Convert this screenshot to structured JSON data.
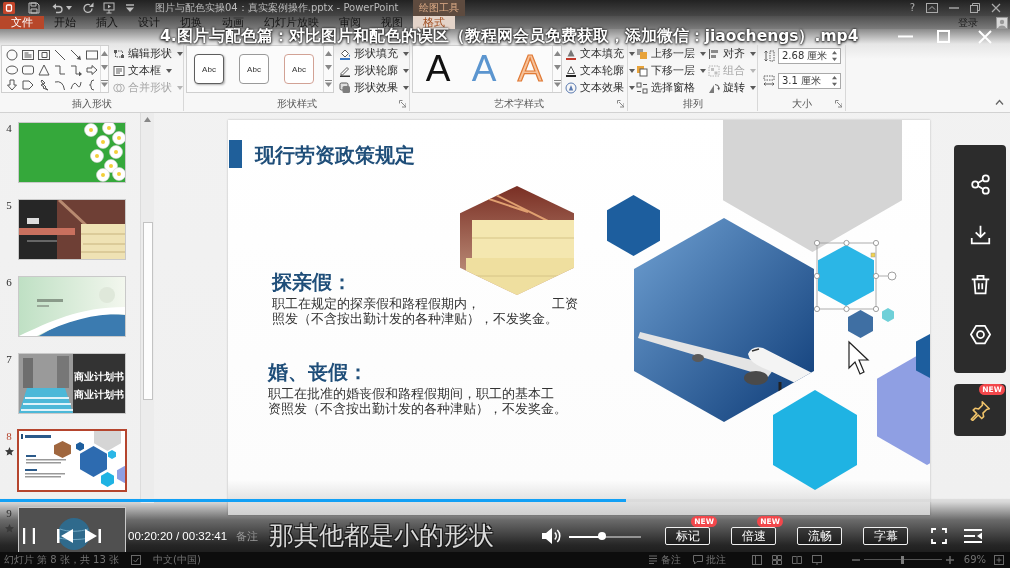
{
  "app": {
    "title": "图片与配色实操04：真实案例操作.pptx - PowerPoint",
    "context_label": "绘图工具",
    "help": "?",
    "tabs": [
      {
        "label": "文件",
        "kind": "file",
        "selected": false
      },
      {
        "label": "开始",
        "kind": "tab",
        "selected": false
      },
      {
        "label": "插入",
        "kind": "tab",
        "selected": false
      },
      {
        "label": "设计",
        "kind": "tab",
        "selected": false
      },
      {
        "label": "切换",
        "kind": "tab",
        "selected": false
      },
      {
        "label": "动画",
        "kind": "tab",
        "selected": false
      },
      {
        "label": "幻灯片放映",
        "kind": "tab",
        "selected": false
      },
      {
        "label": "审阅",
        "kind": "tab",
        "selected": false
      },
      {
        "label": "视图",
        "kind": "tab",
        "selected": false
      },
      {
        "label": "格式",
        "kind": "tab",
        "selected": true
      }
    ],
    "sign_in": "登录",
    "ribbon": [
      {
        "kind": "shapes",
        "label": "插入形状",
        "dialog_launcher": false,
        "commands": [
          {
            "label": "编辑形状",
            "dropdown": true,
            "disabled": false
          },
          {
            "label": "文本框",
            "dropdown": true,
            "disabled": false
          },
          {
            "label": "合并形状",
            "dropdown": true,
            "disabled": true
          }
        ]
      },
      {
        "kind": "styles",
        "label": "形状样式",
        "dialog_launcher": true,
        "swatches": [
          "Abc",
          "Abc",
          "Abc"
        ],
        "commands": [
          {
            "label": "形状填充",
            "dropdown": true,
            "disabled": false
          },
          {
            "label": "形状轮廓",
            "dropdown": true,
            "disabled": false
          },
          {
            "label": "形状效果",
            "dropdown": true,
            "disabled": false
          }
        ]
      },
      {
        "kind": "wordart",
        "label": "艺术字样式",
        "dialog_launcher": true,
        "swatches": [
          "A",
          "A",
          "A"
        ],
        "commands": [
          {
            "label": "文本填充",
            "dropdown": true,
            "disabled": false
          },
          {
            "label": "文本轮廓",
            "dropdown": true,
            "disabled": false
          },
          {
            "label": "文本效果",
            "dropdown": true,
            "disabled": false
          }
        ]
      },
      {
        "kind": "arrange",
        "label": "排列",
        "dialog_launcher": false,
        "commands": [
          {
            "label": "上移一层",
            "dropdown": true,
            "disabled": false
          },
          {
            "label": "下移一层",
            "dropdown": true,
            "disabled": false
          },
          {
            "label": "选择窗格",
            "dropdown": false,
            "disabled": false
          },
          {
            "label": "对齐",
            "dropdown": true,
            "disabled": false
          },
          {
            "label": "组合",
            "dropdown": true,
            "disabled": true
          },
          {
            "label": "旋转",
            "dropdown": true,
            "disabled": false
          }
        ]
      },
      {
        "kind": "size",
        "label": "大小",
        "dialog_launcher": true,
        "fields": [
          {
            "value": "2.68 厘米"
          },
          {
            "value": "3.1 厘米"
          }
        ]
      }
    ],
    "slides": [
      {
        "number": "4",
        "kind": "flowers",
        "selected": false,
        "animated": false
      },
      {
        "number": "5",
        "kind": "books",
        "selected": false,
        "animated": false
      },
      {
        "number": "6",
        "kind": "landscape",
        "selected": false,
        "animated": false
      },
      {
        "number": "7",
        "kind": "city",
        "selected": false,
        "animated": false,
        "texts": [
          "商业计划书",
          "商业计划书"
        ]
      },
      {
        "number": "8",
        "kind": "hexagons",
        "selected": true,
        "animated": true
      },
      {
        "number": "9",
        "kind": "globe",
        "selected": false,
        "animated": true
      }
    ],
    "slide": {
      "title": "现行劳资政策规定",
      "sections": [
        {
          "heading": "探亲假：",
          "lines": [
            [
              "职工在规定的探亲假和路程假期内，",
              "工资"
            ],
            [
              "照发（不含按出勤计发的各种津贴），不发奖金。"
            ]
          ]
        },
        {
          "heading": "婚、丧假：",
          "lines": [
            [
              "职工在批准的婚丧假和路程假期间，职工的基本工"
            ],
            [
              "资照发（不含按出勤计发的各种津贴），不发奖金。"
            ]
          ]
        }
      ]
    },
    "notes": "备注",
    "status_bar": {
      "slide_info": "幻灯片 第 8 张，共 13 张",
      "language": "中文(中国)",
      "notes": "备注",
      "comments": "批注",
      "zoom": {
        "level": 0.5,
        "reading": "69%"
      }
    }
  },
  "player": {
    "title": "4.图片与配色篇：对比图片和配色的误区（教程网会员免费获取，添加微信：jiaochengs）.mp4",
    "playing": true,
    "progress": {
      "level": 0.62
    },
    "time": "00:20:20 / 00:32:41",
    "subtitle": "那其他都是小的形状",
    "volume": {
      "level": 0.46
    },
    "buttons": [
      {
        "label": "标记",
        "badge": "NEW"
      },
      {
        "label": "倍速",
        "badge": "NEW"
      },
      {
        "label": "流畅"
      },
      {
        "label": "字幕"
      }
    ],
    "pin_badge": "NEW"
  }
}
